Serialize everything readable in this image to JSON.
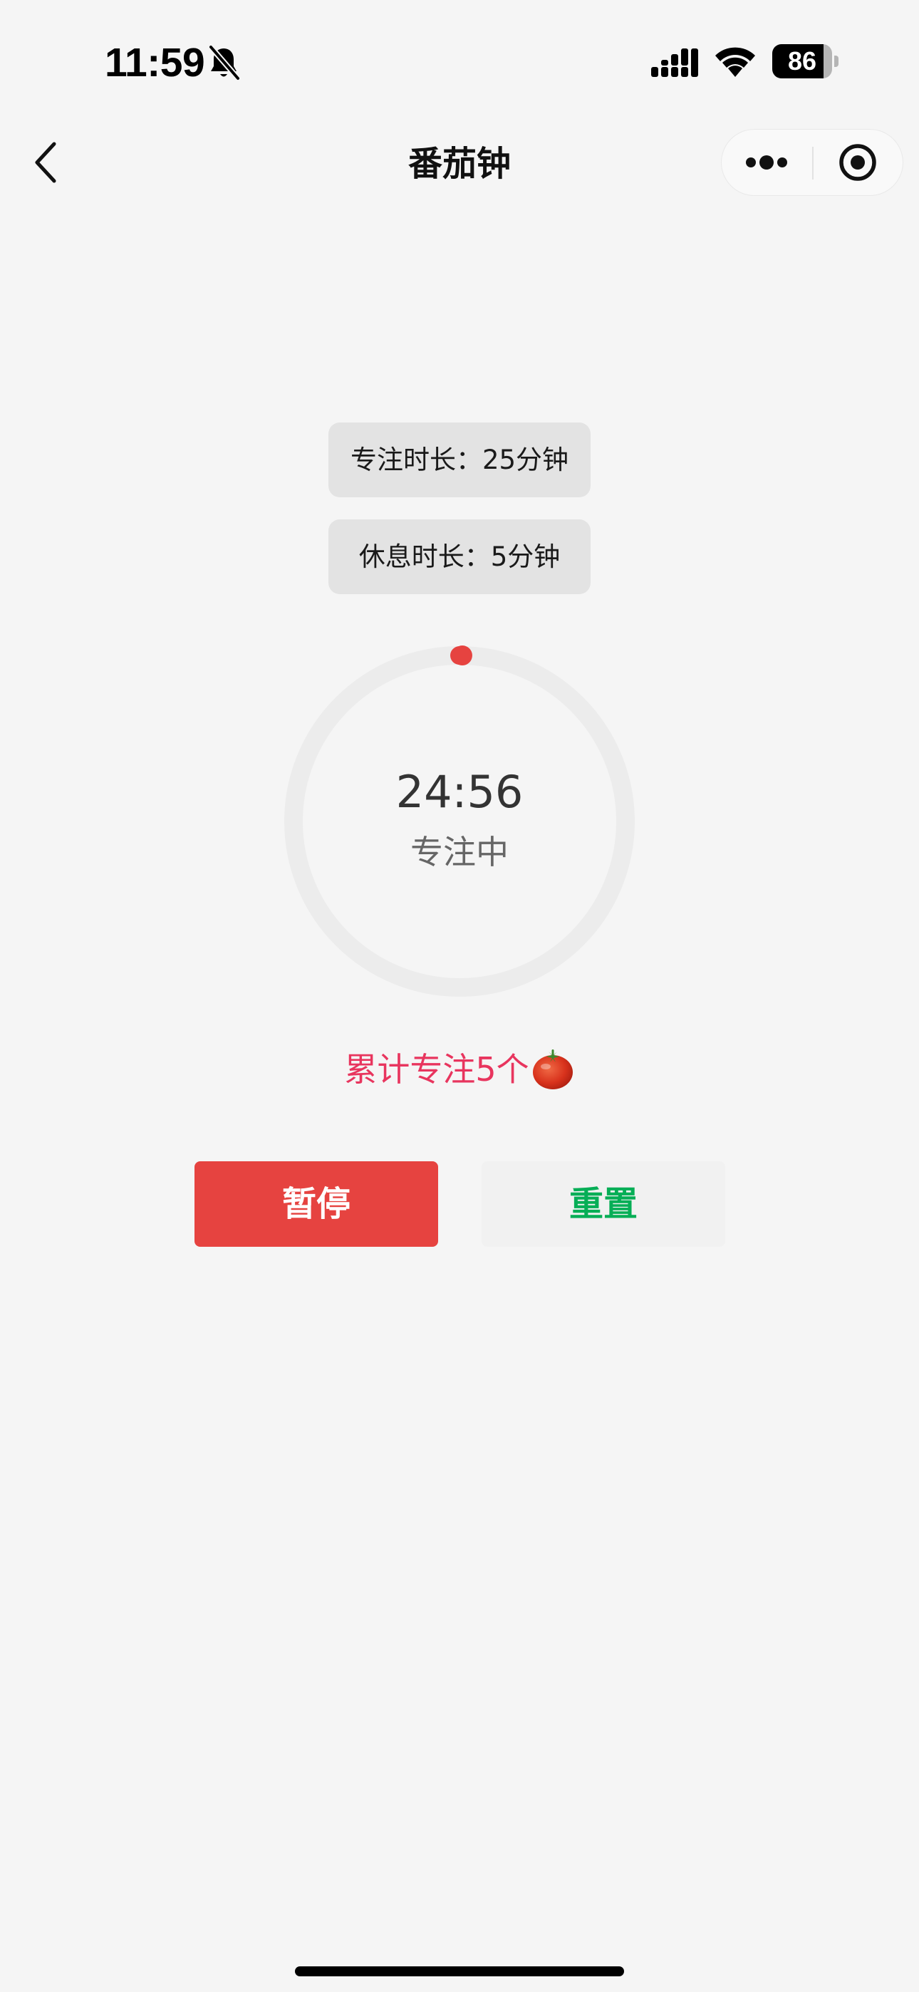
{
  "status_bar": {
    "time": "11:59",
    "battery_level": "86",
    "battery_fraction": 0.86,
    "icons": [
      "bell-slash-icon",
      "cellular-signal-icon",
      "wifi-icon",
      "battery-icon"
    ]
  },
  "nav": {
    "title": "番茄钟",
    "icons": [
      "chevron-left-icon",
      "more-dots-icon",
      "close-target-icon"
    ]
  },
  "settings": {
    "focus_duration": "专注时长：25分钟",
    "rest_duration": "休息时长：5分钟"
  },
  "timer": {
    "time": "24:56",
    "status": "专注中",
    "elapsed_fraction": 0.0027,
    "track_color": "#ececec",
    "progress_color": "#e64340"
  },
  "stats": {
    "text": "累计专注5个",
    "icon": "tomato-icon"
  },
  "controls": {
    "pause_label": "暂停",
    "reset_label": "重置",
    "pause_color": "#e64340",
    "reset_text_color": "#06ae56"
  }
}
